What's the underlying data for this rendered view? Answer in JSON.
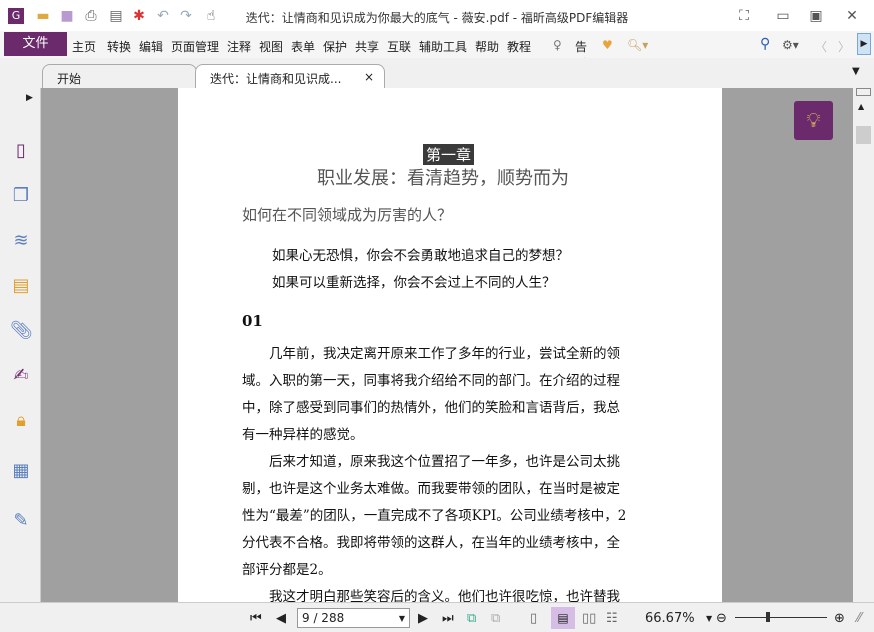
{
  "window": {
    "title": "迭代：让情商和见识成为你最大的底气 - 薇安.pdf - 福昕高级PDF编辑器"
  },
  "menu": {
    "file": "文件",
    "items": [
      "主页",
      "转换",
      "编辑",
      "页面管理",
      "注释",
      "视图",
      "表单",
      "保护",
      "共享",
      "互联",
      "辅助工具",
      "帮助",
      "教程"
    ],
    "tell": "告诉",
    "search_placeholder": "查找"
  },
  "tabs": [
    {
      "label": "开始"
    },
    {
      "label": "迭代：让情商和见识成...",
      "close": "×"
    }
  ],
  "doc": {
    "chapter": "第一章",
    "title": "职业发展：看清趋势，顺势而为",
    "heading": "如何在不同领域成为厉害的人？",
    "quotes": [
      "如果心无恐惧，你会不会勇敢地追求自己的梦想？",
      "如果可以重新选择，你会不会过上不同的人生？"
    ],
    "section": "01",
    "lines": [
      "　　几年前，我决定离开原来工作了多年的行业，尝试全新的领",
      "域。入职的第一天，同事将我介绍给不同的部门。在介绍的过程",
      "中，除了感受到同事们的热情外，他们的笑脸和言语背后，我总",
      "有一种异样的感觉。",
      "　　后来才知道，原来我这个位置招了一年多，也许是公司太挑",
      "剔，也许是这个业务太难做。而我要带领的团队，在当时是被定",
      "性为“最差”的团队，一直完成不了各项KPI。公司业绩考核中，2",
      "分代表不合格。我即将带领的这群人，在当年的业绩考核中，全",
      "部评分都是2。",
      "　　我这才明白那些笑容后的含义。他们也许很吃惊，也许替我"
    ]
  },
  "status": {
    "page": "9 / 288",
    "zoom": "66.67%"
  },
  "colors": {
    "brand": "#6b2a6b"
  }
}
